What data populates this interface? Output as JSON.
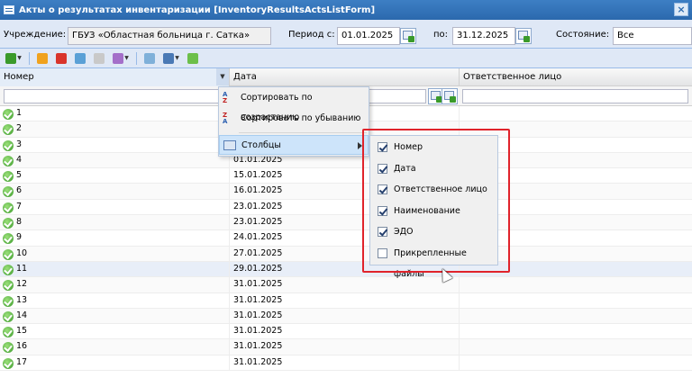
{
  "window": {
    "title": "Акты о результатах инвентаризации [InventoryResultsActsListForm]"
  },
  "filters": {
    "institution_label": "Учреждение:",
    "institution_value": "ГБУЗ «Областная больница г. Сатка»",
    "period_from_label": "Период с:",
    "period_from_value": "01.01.2025",
    "period_to_label": "по:",
    "period_to_value": "31.12.2025",
    "state_label": "Состояние:",
    "state_value": "Все"
  },
  "columns": {
    "number": "Номер",
    "date": "Дата",
    "responsible": "Ответственное лицо"
  },
  "rows": [
    {
      "num": "1",
      "date": ""
    },
    {
      "num": "2",
      "date": ""
    },
    {
      "num": "3",
      "date": ""
    },
    {
      "num": "4",
      "date": "01.01.2025"
    },
    {
      "num": "5",
      "date": "15.01.2025"
    },
    {
      "num": "6",
      "date": "16.01.2025"
    },
    {
      "num": "7",
      "date": "23.01.2025"
    },
    {
      "num": "8",
      "date": "23.01.2025"
    },
    {
      "num": "9",
      "date": "24.01.2025"
    },
    {
      "num": "10",
      "date": "27.01.2025"
    },
    {
      "num": "11",
      "date": "29.01.2025"
    },
    {
      "num": "12",
      "date": "31.01.2025"
    },
    {
      "num": "13",
      "date": "31.01.2025"
    },
    {
      "num": "14",
      "date": "31.01.2025"
    },
    {
      "num": "15",
      "date": "31.01.2025"
    },
    {
      "num": "16",
      "date": "31.01.2025"
    },
    {
      "num": "17",
      "date": "31.01.2025"
    }
  ],
  "column_menu": {
    "sort_asc": "Сортировать по возрастанию",
    "sort_desc": "Сортировать по убыванию",
    "columns": "Столбцы"
  },
  "columns_submenu": [
    {
      "label": "Номер",
      "checked": true
    },
    {
      "label": "Дата",
      "checked": true
    },
    {
      "label": "Ответственное лицо",
      "checked": true
    },
    {
      "label": "Наименование",
      "checked": true
    },
    {
      "label": "ЭДО",
      "checked": true
    },
    {
      "label": "Прикрепленные файлы",
      "checked": false
    }
  ],
  "colors": {
    "title_bar": "#2b69ad",
    "highlight": "#e0232b",
    "ok_icon": "#3a9a2a"
  }
}
